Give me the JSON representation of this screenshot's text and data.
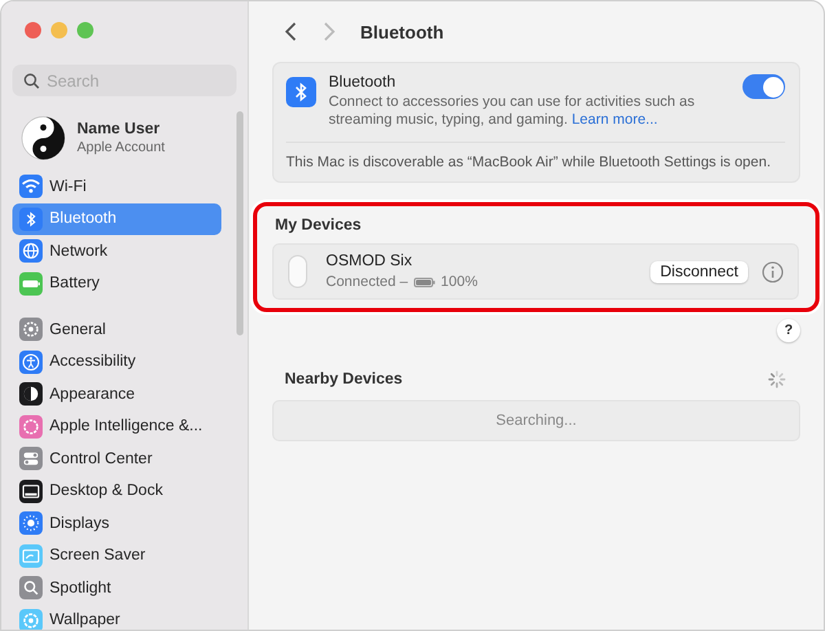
{
  "window": {
    "title": "Bluetooth"
  },
  "sidebar": {
    "search": {
      "placeholder": "Search"
    },
    "account": {
      "name": "Name User",
      "subtitle": "Apple Account"
    },
    "groups": [
      [
        {
          "label": "Wi-Fi",
          "kind": "wifi",
          "color": "#2f7cf6",
          "selected": false
        },
        {
          "label": "Bluetooth",
          "kind": "bluetooth",
          "color": "#2f7cf6",
          "selected": true
        },
        {
          "label": "Network",
          "kind": "network",
          "color": "#2f7cf6",
          "selected": false
        },
        {
          "label": "Battery",
          "kind": "battery",
          "color": "#4cc553",
          "selected": false
        }
      ],
      [
        {
          "label": "General",
          "kind": "general",
          "color": "#8e8e93",
          "selected": false
        },
        {
          "label": "Accessibility",
          "kind": "accessibility",
          "color": "#2f7cf6",
          "selected": false
        },
        {
          "label": "Appearance",
          "kind": "appearance",
          "color": "#1c1c1e",
          "selected": false
        },
        {
          "label": "Apple Intelligence &...",
          "kind": "intelligence",
          "color": "#e86fb0",
          "selected": false
        },
        {
          "label": "Control Center",
          "kind": "control",
          "color": "#8e8e93",
          "selected": false
        },
        {
          "label": "Desktop & Dock",
          "kind": "dock",
          "color": "#1c1c1e",
          "selected": false
        },
        {
          "label": "Displays",
          "kind": "displays",
          "color": "#2f7cf6",
          "selected": false
        },
        {
          "label": "Screen Saver",
          "kind": "screensaver",
          "color": "#5ac8fa",
          "selected": false
        },
        {
          "label": "Spotlight",
          "kind": "spotlight",
          "color": "#8e8e93",
          "selected": false
        },
        {
          "label": "Wallpaper",
          "kind": "wallpaper",
          "color": "#5ac8fa",
          "selected": false
        }
      ]
    ]
  },
  "toolbar": {
    "back": {
      "disabled": false
    },
    "forward": {
      "disabled": true
    }
  },
  "bluetooth_card": {
    "title": "Bluetooth",
    "description": "Connect to accessories you can use for activities such as streaming music, typing, and gaming.",
    "link": "Learn more...",
    "on": true,
    "note": "This Mac is discoverable as “MacBook Air” while Bluetooth Settings is open."
  },
  "my_devices": {
    "heading": "My Devices",
    "devices": [
      {
        "name": "OSMOD Six",
        "status": "Connected –",
        "battery": "100%",
        "level": 1,
        "button": "Disconnect"
      }
    ]
  },
  "help": "?",
  "nearby_devices": {
    "heading": "Nearby Devices",
    "status": "Searching..."
  }
}
